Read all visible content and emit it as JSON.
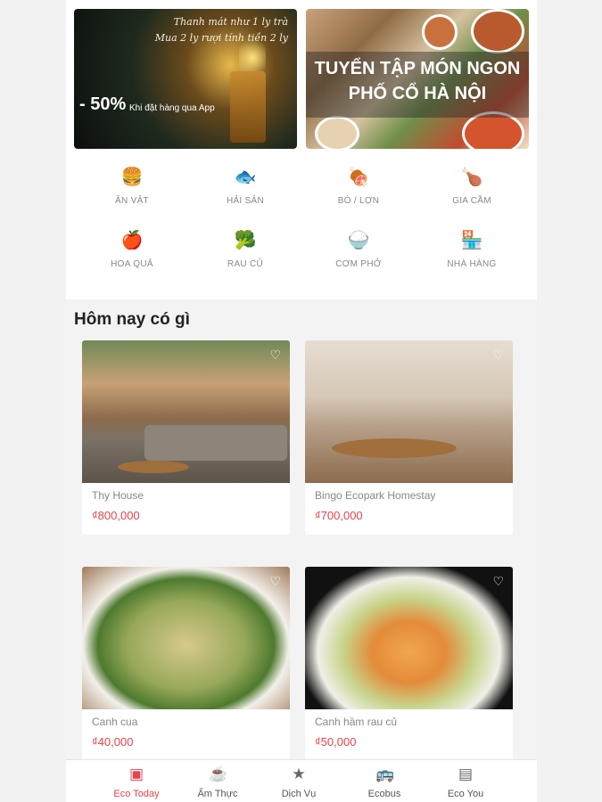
{
  "banners": {
    "promo": {
      "script_line_1": "Thanh mát như 1 ly trà",
      "script_line_2": "Mua 2 ly rượi tính tiền 2 ly",
      "discount": "- 50%",
      "discount_note": "Khi đặt hàng qua App"
    },
    "food": {
      "line_1": "TUYỂN TẬP MÓN NGON",
      "line_2": "PHỐ CỔ HÀ NỘI"
    }
  },
  "categories": [
    {
      "label": "ĂN VẶT",
      "icon": "🍔"
    },
    {
      "label": "HẢI SẢN",
      "icon": "🐟"
    },
    {
      "label": "BÒ / LỢN",
      "icon": "🍖"
    },
    {
      "label": "GIA CẦM",
      "icon": "🍗"
    },
    {
      "label": "HOA QUẢ",
      "icon": "🍎"
    },
    {
      "label": "RAU CỦ",
      "icon": "🥦"
    },
    {
      "label": "CƠM PHỞ",
      "icon": "🍚"
    },
    {
      "label": "NHÀ HÀNG",
      "icon": "🏪"
    }
  ],
  "section": {
    "title": "Hôm nay có gì"
  },
  "listings": [
    {
      "name": "Thy House",
      "price": "₫800,000"
    },
    {
      "name": "Bingo Ecopark Homestay",
      "price": "₫700,000"
    },
    {
      "name": "Canh cua",
      "price": "₫40,000"
    },
    {
      "name": "Canh hầm rau củ",
      "price": "₫50,000"
    }
  ],
  "tabs": [
    {
      "label": "Eco Today",
      "icon": "▣",
      "active": true
    },
    {
      "label": "Ẩm Thực",
      "icon": "☕",
      "active": false
    },
    {
      "label": "Dịch Vụ",
      "icon": "★",
      "active": false
    },
    {
      "label": "Ecobus",
      "icon": "🚌",
      "active": false
    },
    {
      "label": "Eco You",
      "icon": "▤",
      "active": false
    }
  ],
  "colors": {
    "accent": "#e8424c",
    "background": "#f3f3f3"
  }
}
